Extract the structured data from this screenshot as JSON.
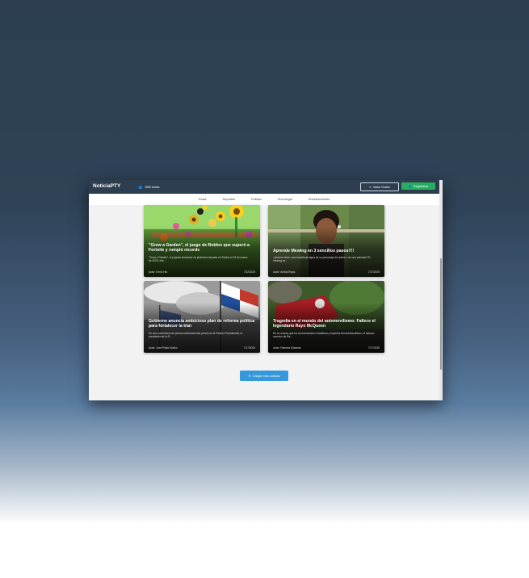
{
  "navbar": {
    "brand": "NoticiaPTY",
    "visits_icon": "users-icon",
    "visits": "1550 visitas",
    "login_icon": "sign-in-icon",
    "login_label": "Iniciar Sesión",
    "register_icon": "user-plus-icon",
    "register_label": "Registrarse"
  },
  "categories": [
    "Todas",
    "Deportes",
    "Política",
    "Tecnología",
    "Entretenimiento"
  ],
  "cards": [
    {
      "title": "\"Grow a Garden\", el juego de Roblox que superó a Fortnite y rompió récords",
      "description": "\"Grow a Garden\", el popular simulador de jardinería lanzado en Roblox el 26 de marzo de 2025, ofre...",
      "author": "Autor: Kevin Hai",
      "date": "7/22/2025"
    },
    {
      "title": "Aprende Mewing en 3 sencillos pasos!!!!",
      "description": "¿Quieres tener una mandíbula digna de un personaje de anime o de una película? El mewing es...",
      "author": "Autor: Aníbal Rojas",
      "date": "7/17/2025"
    },
    {
      "title": "Gobierno anuncia ambicioso plan de reforma política para fortalecer la tran",
      "description": "En una conferencia de prensa celebrada este jueves en el Palacio Presidencial, la presidenta de la R...",
      "author": "Autor: José Pablo Muñoz",
      "date": "7/17/2025"
    },
    {
      "title": "Tragedia en el mundo del automovilismo: Fallece el legendario Rayo McQueen",
      "description": "En un suceso que ha conmocionado a fanáticos y expertos del automovilismo, el famoso corredor de Ra...",
      "author": "Autor: Ramses Sotomás",
      "date": "7/17/2025"
    }
  ],
  "load_more": {
    "icon": "refresh-icon",
    "label": "Cargar más noticias"
  },
  "colors": {
    "navbar": "#2c3e50",
    "register": "#27ae60",
    "load_more": "#3498db"
  }
}
